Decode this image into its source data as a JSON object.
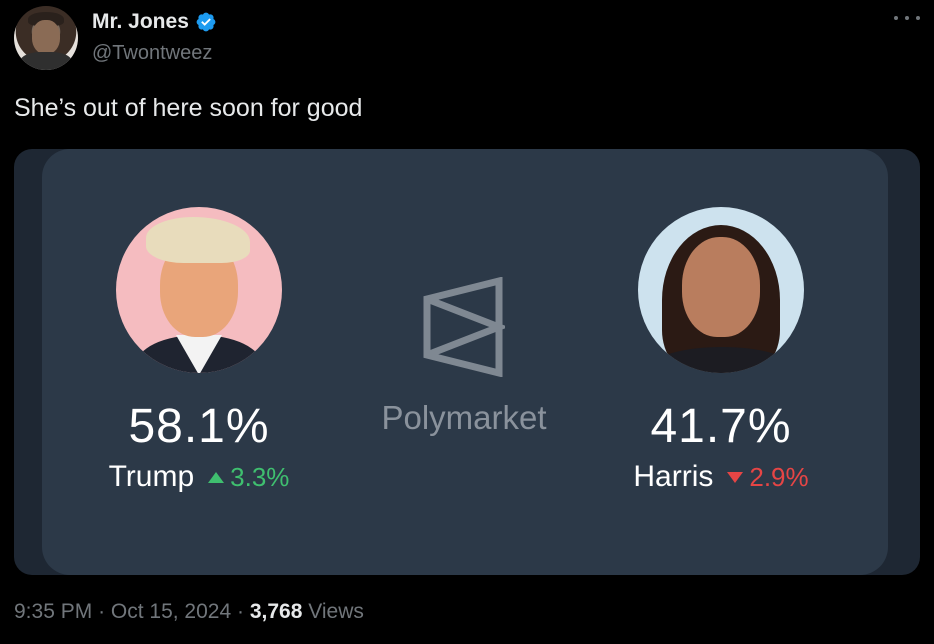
{
  "author": {
    "name": "Mr. Jones",
    "handle": "@Twontweez",
    "verified": true,
    "avatar_icon": "user-avatar"
  },
  "tweet": {
    "text": "She’s out of here soon for good"
  },
  "media": {
    "brand": "Polymarket",
    "logo_icon": "polymarket-logo-icon",
    "candidates": [
      {
        "name": "Trump",
        "percent": "58.1%",
        "change": "3.3%",
        "direction": "up",
        "color": "#3fbf6f"
      },
      {
        "name": "Harris",
        "percent": "41.7%",
        "change": "2.9%",
        "direction": "down",
        "color": "#e64545"
      }
    ]
  },
  "footer": {
    "time": "9:35 PM",
    "date": "Oct 15, 2024",
    "separator": "·",
    "views_count": "3,768",
    "views_label": "Views"
  }
}
